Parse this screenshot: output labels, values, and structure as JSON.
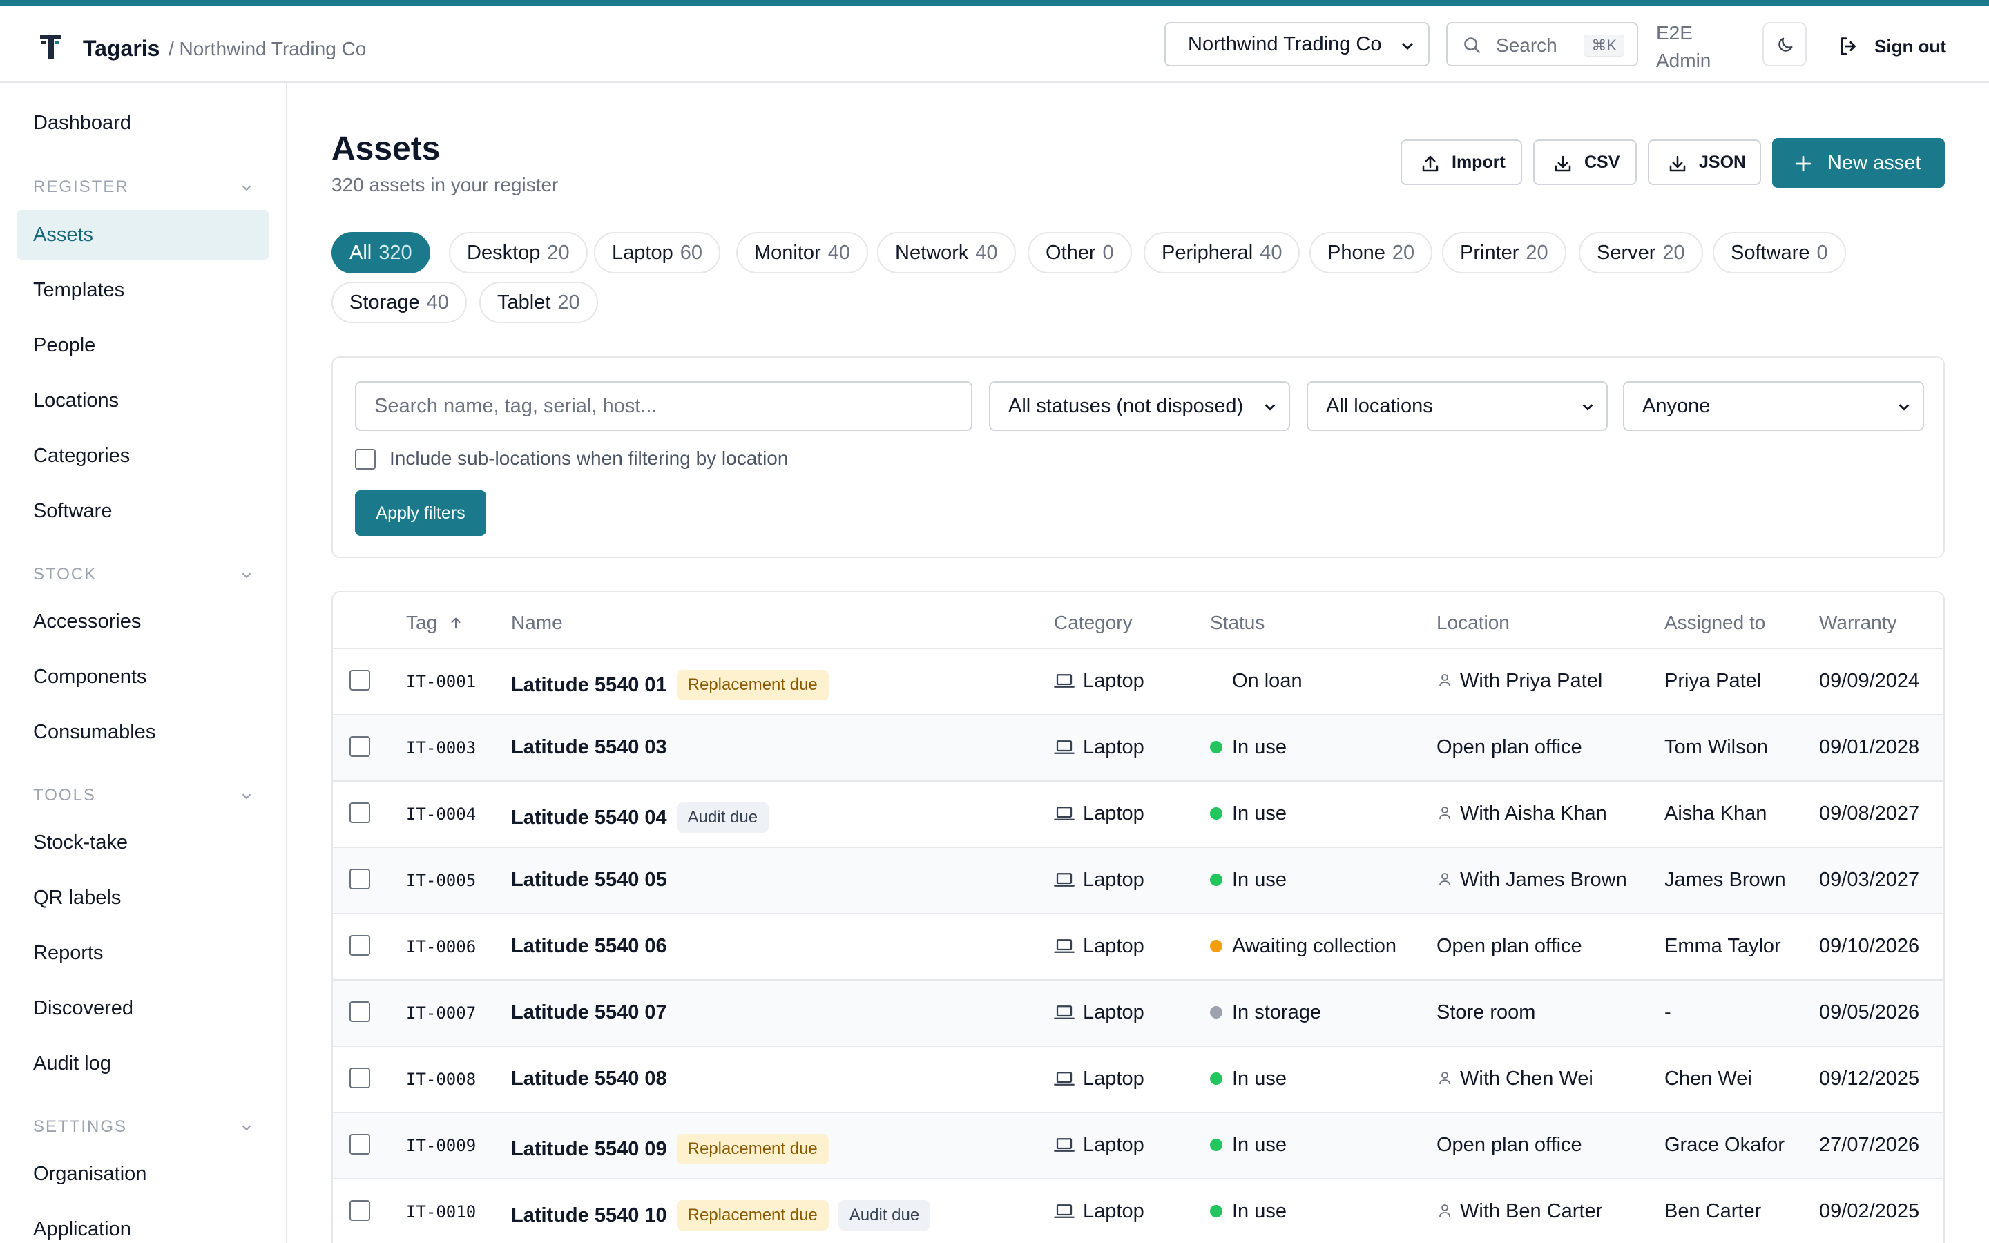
{
  "header": {
    "brand": "Tagaris",
    "org_crumb": "/ Northwind Trading Co",
    "org_select": "Northwind Trading Co",
    "search_label": "Search",
    "search_shortcut": "⌘K",
    "user_line1": "E2E",
    "user_line2": "Admin",
    "sign_out": "Sign out"
  },
  "sidebar": {
    "dashboard": "Dashboard",
    "register_title": "REGISTER",
    "register": [
      "Assets",
      "Templates",
      "People",
      "Locations",
      "Categories",
      "Software"
    ],
    "stock_title": "STOCK",
    "stock": [
      "Accessories",
      "Components",
      "Consumables"
    ],
    "tools_title": "TOOLS",
    "tools": [
      "Stock-take",
      "QR labels",
      "Reports",
      "Discovered",
      "Audit log"
    ],
    "settings_title": "SETTINGS",
    "settings": [
      "Organisation",
      "Application"
    ]
  },
  "page": {
    "title": "Assets",
    "subtitle": "320 assets in your register",
    "import": "Import",
    "csv": "CSV",
    "json": "JSON",
    "new_asset": "New asset"
  },
  "chips": [
    {
      "label": "All",
      "count": "320",
      "active": true
    },
    {
      "label": "Desktop",
      "count": "20"
    },
    {
      "label": "Laptop",
      "count": "60"
    },
    {
      "label": "Monitor",
      "count": "40"
    },
    {
      "label": "Network",
      "count": "40"
    },
    {
      "label": "Other",
      "count": "0"
    },
    {
      "label": "Peripheral",
      "count": "40"
    },
    {
      "label": "Phone",
      "count": "20"
    },
    {
      "label": "Printer",
      "count": "20"
    },
    {
      "label": "Server",
      "count": "20"
    },
    {
      "label": "Software",
      "count": "0"
    },
    {
      "label": "Storage",
      "count": "40"
    },
    {
      "label": "Tablet",
      "count": "20"
    }
  ],
  "filters": {
    "search_placeholder": "Search name, tag, serial, host...",
    "status": "All statuses (not disposed)",
    "location": "All locations",
    "assignee": "Anyone",
    "sub_locations": "Include sub-locations when filtering by location",
    "apply": "Apply filters"
  },
  "table": {
    "columns": [
      "Tag",
      "Name",
      "Category",
      "Status",
      "Location",
      "Assigned to",
      "Warranty"
    ],
    "rows": [
      {
        "tag": "IT-0001",
        "name": "Latitude 5540 01",
        "badges": [
          "Replacement due"
        ],
        "category": "Laptop",
        "status": "On loan",
        "status_color": "",
        "location": "With Priya Patel",
        "location_person": true,
        "assigned": "Priya Patel",
        "warranty": "09/09/2024"
      },
      {
        "tag": "IT-0003",
        "name": "Latitude 5540 03",
        "badges": [],
        "category": "Laptop",
        "status": "In use",
        "status_color": "#22c55e",
        "location": "Open plan office",
        "location_person": false,
        "assigned": "Tom Wilson",
        "warranty": "09/01/2028"
      },
      {
        "tag": "IT-0004",
        "name": "Latitude 5540 04",
        "badges": [
          "Audit due"
        ],
        "category": "Laptop",
        "status": "In use",
        "status_color": "#22c55e",
        "location": "With Aisha Khan",
        "location_person": true,
        "assigned": "Aisha Khan",
        "warranty": "09/08/2027"
      },
      {
        "tag": "IT-0005",
        "name": "Latitude 5540 05",
        "badges": [],
        "category": "Laptop",
        "status": "In use",
        "status_color": "#22c55e",
        "location": "With James Brown",
        "location_person": true,
        "assigned": "James Brown",
        "warranty": "09/03/2027"
      },
      {
        "tag": "IT-0006",
        "name": "Latitude 5540 06",
        "badges": [],
        "category": "Laptop",
        "status": "Awaiting collection",
        "status_color": "#f59e0b",
        "location": "Open plan office",
        "location_person": false,
        "assigned": "Emma Taylor",
        "warranty": "09/10/2026"
      },
      {
        "tag": "IT-0007",
        "name": "Latitude 5540 07",
        "badges": [],
        "category": "Laptop",
        "status": "In storage",
        "status_color": "#9ca3af",
        "location": "Store room",
        "location_person": false,
        "assigned": "-",
        "warranty": "09/05/2026"
      },
      {
        "tag": "IT-0008",
        "name": "Latitude 5540 08",
        "badges": [],
        "category": "Laptop",
        "status": "In use",
        "status_color": "#22c55e",
        "location": "With Chen Wei",
        "location_person": true,
        "assigned": "Chen Wei",
        "warranty": "09/12/2025"
      },
      {
        "tag": "IT-0009",
        "name": "Latitude 5540 09",
        "badges": [
          "Replacement due"
        ],
        "category": "Laptop",
        "status": "In use",
        "status_color": "#22c55e",
        "location": "Open plan office",
        "location_person": false,
        "assigned": "Grace Okafor",
        "warranty": "27/07/2026"
      },
      {
        "tag": "IT-0010",
        "name": "Latitude 5540 10",
        "badges": [
          "Replacement due",
          "Audit due"
        ],
        "category": "Laptop",
        "status": "In use",
        "status_color": "#22c55e",
        "location": "With Ben Carter",
        "location_person": true,
        "assigned": "Ben Carter",
        "warranty": "09/02/2025"
      }
    ]
  },
  "colors": {
    "accent": "#1a7a8c",
    "active_nav_bg": "#e6f1f3",
    "in_use": "#22c55e",
    "awaiting": "#f59e0b",
    "storage": "#9ca3af"
  }
}
